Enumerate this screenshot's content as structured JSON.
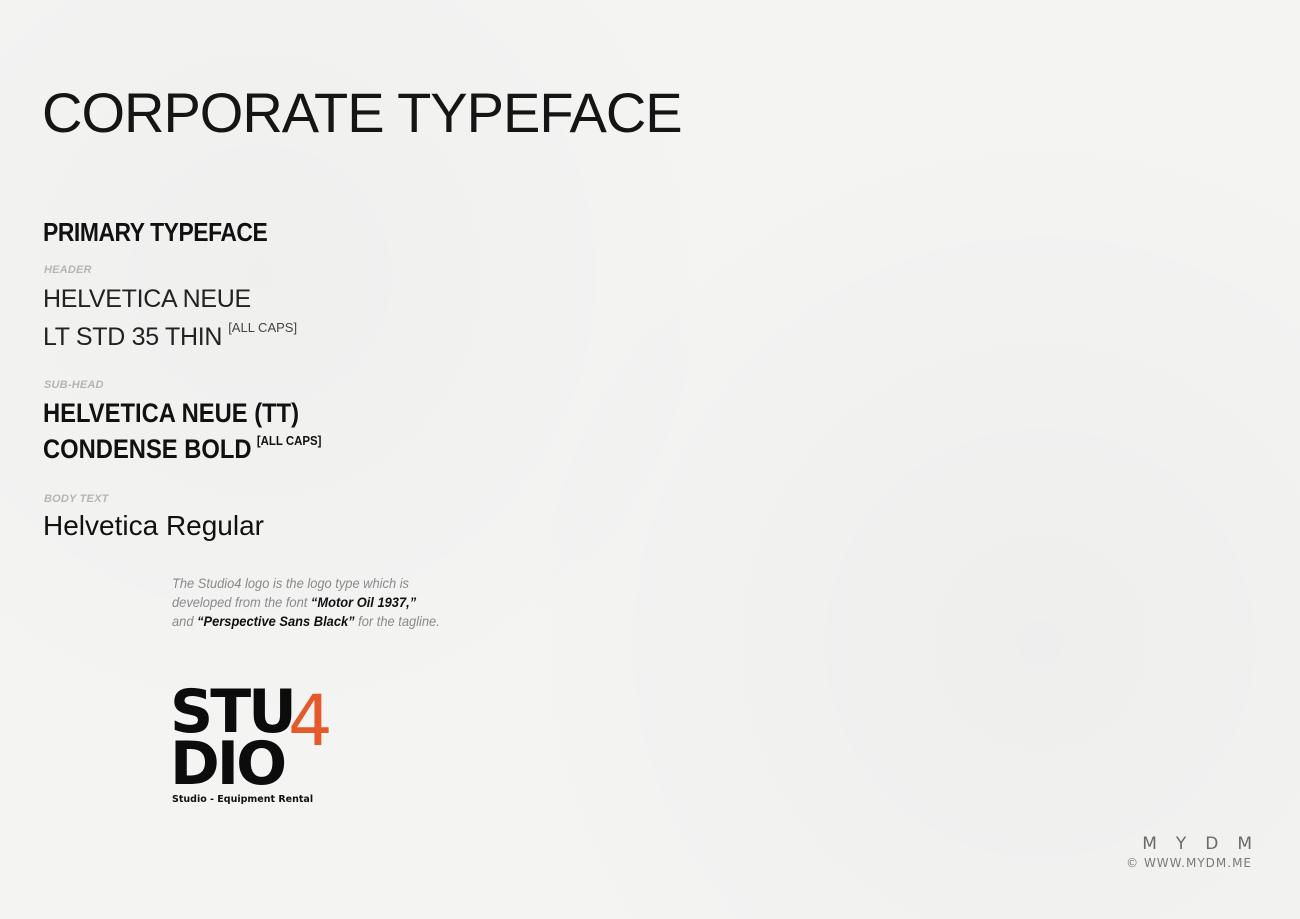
{
  "title": "CORPORATE TYPEFACE",
  "primary": {
    "heading": "PRIMARY TYPEFACE",
    "header": {
      "label": "HEADER",
      "line1": "HELVETICA NEUE",
      "line2": "LT STD 35 THIN",
      "note": "[ALL CAPS]"
    },
    "subhead": {
      "label": "SUB-HEAD",
      "line1": "HELVETICA NEUE (TT)",
      "line2": "CONDENSE BOLD",
      "note": "[ALL CAPS]"
    },
    "body": {
      "label": "BODY TEXT",
      "line1": "Helvetica Regular"
    }
  },
  "description": {
    "line1": "The Studio4 logo is the logo type which is",
    "line2_pre": "developed from the font ",
    "line2_bold": "“Motor Oil 1937,”",
    "line3_pre": "and ",
    "line3_bold": "“Perspective Sans Black”",
    "line3_post": " for the tagline."
  },
  "logo": {
    "row1": "STU",
    "row2": "DIO",
    "digit": "4",
    "tagline": "Studio - Equipment Rental",
    "accent_color": "#e5592a"
  },
  "watermark": {
    "name": "MYDM",
    "website": "© WWW.MYDM.ME"
  }
}
